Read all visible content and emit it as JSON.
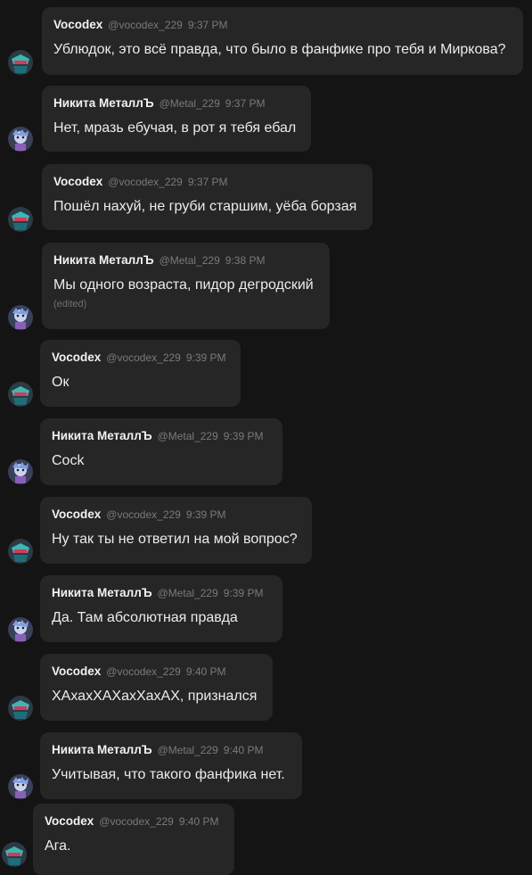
{
  "users": {
    "vocodex": {
      "name": "Vocodex",
      "handle": "@vocodex_229",
      "avatar_icon": "vocodex-avatar-icon"
    },
    "nikita": {
      "name": "Никита МеталлЪ",
      "handle": "@Metal_229",
      "avatar_icon": "nikita-avatar-icon"
    }
  },
  "edited_label": "(edited)",
  "messages": [
    {
      "author": "Vocodex",
      "handle": "@vocodex_229",
      "time": "9:37 PM",
      "text": "Ублюдок, это всё правда, что было в фанфике про тебя и Миркова?"
    },
    {
      "author": "Никита МеталлЪ",
      "handle": "@Metal_229",
      "time": "9:37 PM",
      "text": "Нет, мразь ебучая, в рот я тебя ебал"
    },
    {
      "author": "Vocodex",
      "handle": "@vocodex_229",
      "time": "9:37 PM",
      "text": "Пошёл нахуй, не груби старшим, уёба борзая"
    },
    {
      "author": "Никита МеталлЪ",
      "handle": "@Metal_229",
      "time": "9:38 PM",
      "text": "Мы одного возраста, пидор дегродский",
      "edited": "(edited)"
    },
    {
      "author": "Vocodex",
      "handle": "@vocodex_229",
      "time": "9:39 PM",
      "text": "Ок"
    },
    {
      "author": "Никита МеталлЪ",
      "handle": "@Metal_229",
      "time": "9:39 PM",
      "text": "Cock"
    },
    {
      "author": "Vocodex",
      "handle": "@vocodex_229",
      "time": "9:39 PM",
      "text": "Ну так ты не ответил на мой вопрос?"
    },
    {
      "author": "Никита МеталлЪ",
      "handle": "@Metal_229",
      "time": "9:39 PM",
      "text": "Да. Там абсолютная правда"
    },
    {
      "author": "Vocodex",
      "handle": "@vocodex_229",
      "time": "9:40 PM",
      "text": "ХАхахХАХахХахАХ, признался"
    },
    {
      "author": "Никита МеталлЪ",
      "handle": "@Metal_229",
      "time": "9:40 PM",
      "text": "Учитывая, что такого фанфика нет."
    },
    {
      "author": "Vocodex",
      "handle": "@vocodex_229",
      "time": "9:40 PM",
      "text": "Ага."
    }
  ]
}
